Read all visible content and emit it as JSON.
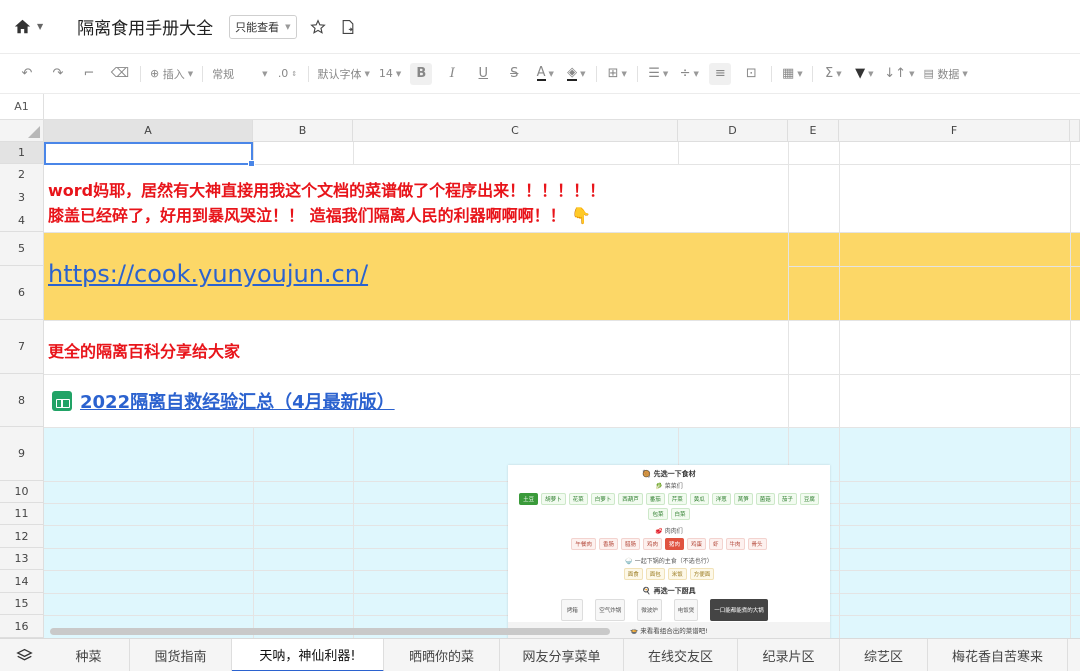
{
  "titlebar": {
    "doc_title": "隔离食用手册大全",
    "mode_label": "只能查看",
    "icons": [
      "home-icon",
      "star-icon",
      "export-icon"
    ]
  },
  "toolbar": {
    "insert_label": "插入",
    "format_label": "常规",
    "decimal_label": ".0",
    "font_label": "默认字体",
    "size_label": "14",
    "data_label": "数据"
  },
  "formula": {
    "cell_ref": "A1"
  },
  "columns": [
    "A",
    "B",
    "C",
    "D",
    "E",
    "F"
  ],
  "rows": [
    "1",
    "2",
    "3",
    "4",
    "5",
    "6",
    "7",
    "8",
    "9",
    "10",
    "11",
    "12",
    "13",
    "14",
    "15",
    "16"
  ],
  "cells": {
    "line1": "word妈耶，居然有大神直接用我这个文档的菜谱做了个程序出来！！！！！！",
    "line2": "膝盖已经碎了，好用到暴风哭泣！！ 造福我们隔离人民的利器啊啊啊！！ 👇",
    "url": "https://cook.yunyoujun.cn/",
    "share_text": "更全的隔离百科分享给大家",
    "sheet_link": "2022隔离自救经验汇总（4月最新版）"
  },
  "embed": {
    "title": "先选一下食材",
    "veg_title": "菜菜们",
    "veg": [
      "土豆",
      "胡萝卜",
      "花菜",
      "白萝卜",
      "西葫芦",
      "番茄",
      "芹菜",
      "黄瓜",
      "洋葱",
      "莴笋",
      "菌菇",
      "茄子",
      "豆腐",
      "包菜",
      "白菜"
    ],
    "meat_title": "肉肉们",
    "meat": [
      "午餐肉",
      "香肠",
      "腊肠",
      "鸡肉",
      "猪肉",
      "鸡蛋",
      "虾",
      "牛肉",
      "骨头"
    ],
    "staple_title": "一起下锅的主食（不选也行）",
    "staple": [
      "面食",
      "面包",
      "米饭",
      "方便面"
    ],
    "tools_title": "再选一下厨具",
    "tools": [
      "烤箱",
      "空气炸锅",
      "微波炉",
      "电饭煲",
      "一口能都能煮的大锅"
    ],
    "bottom_text": "来看看组合出的菜谱吧!"
  },
  "tabs": [
    "种菜",
    "囤货指南",
    "天呐，神仙利器!",
    "晒晒你的菜",
    "网友分享菜单",
    "在线交友区",
    "纪录片区",
    "综艺区",
    "梅花香自苦寒来"
  ],
  "active_tab": 2,
  "colors": {
    "red": "#e8141a",
    "link": "#2b62cf",
    "yellow_band": "#fcd767",
    "cyan_band": "#dff7fd",
    "accent": "#4a86e8"
  }
}
